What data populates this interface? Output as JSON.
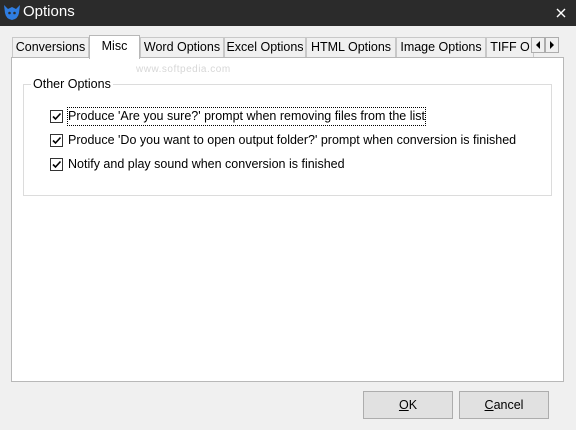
{
  "window": {
    "title": "Options",
    "app_icon": "app-logo-icon",
    "close_icon": "close-icon"
  },
  "tabs": [
    {
      "label": "Conversions",
      "active": false
    },
    {
      "label": "Misc",
      "active": true
    },
    {
      "label": "Word Options",
      "active": false
    },
    {
      "label": "Excel Options",
      "active": false
    },
    {
      "label": "HTML Options",
      "active": false
    },
    {
      "label": "Image Options",
      "active": false
    },
    {
      "label": "TIFF O",
      "active": false
    }
  ],
  "tab_scroll": {
    "left_icon": "chevron-left-icon",
    "right_icon": "chevron-right-icon"
  },
  "misc": {
    "watermark": "www.softpedia.com",
    "group_title": "Other Options",
    "options": [
      {
        "label": "Produce 'Are you sure?' prompt when removing files from the list",
        "checked": true
      },
      {
        "label": "Produce 'Do you want to open output folder?' prompt when conversion is finished",
        "checked": true
      },
      {
        "label": "Notify and play sound when conversion is finished",
        "checked": true
      }
    ]
  },
  "buttons": {
    "ok": {
      "mnemonic": "O",
      "rest": "K"
    },
    "cancel": {
      "mnemonic": "C",
      "rest": "ancel"
    }
  },
  "colors": {
    "titlebar": "#2b2b2b",
    "logo": "#2f7de1"
  }
}
